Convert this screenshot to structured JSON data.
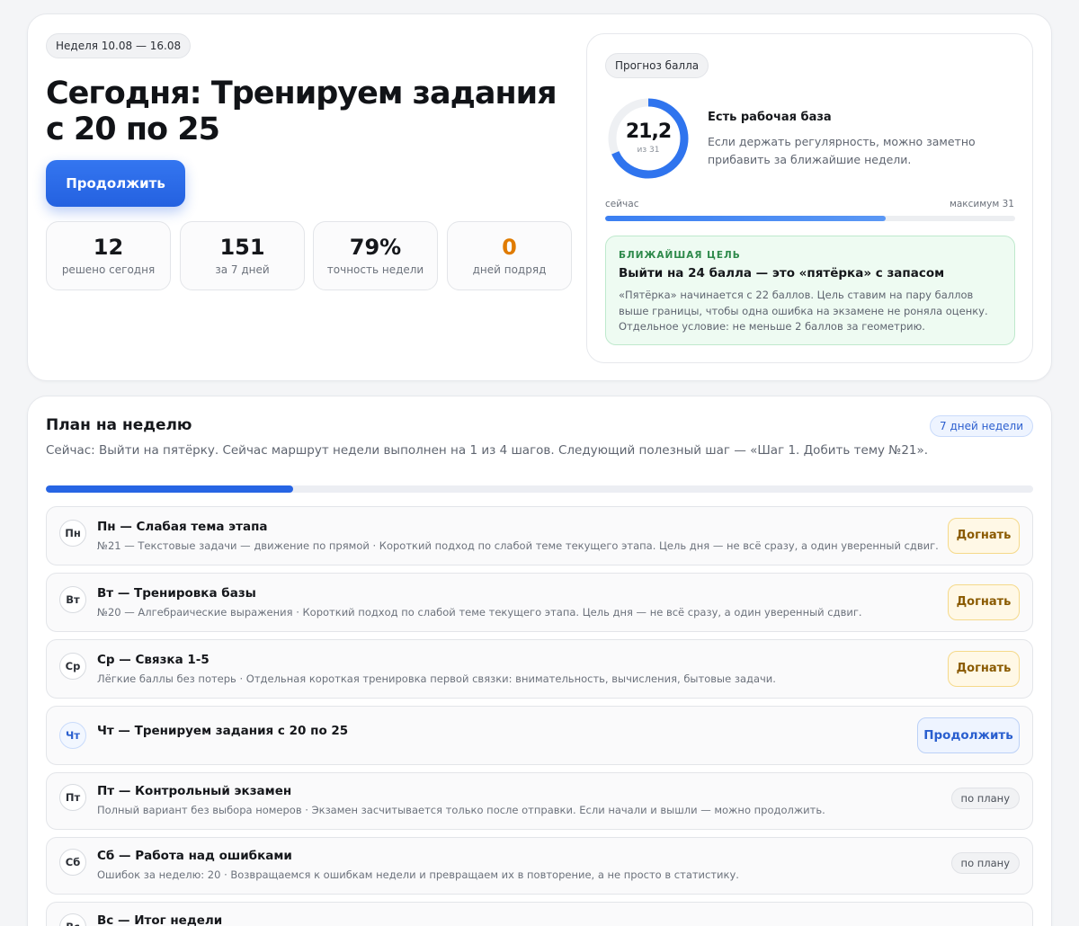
{
  "hero": {
    "week_label": "Неделя 10.08 — 16.08",
    "title": "Сегодня: Тренируем задания с 20 по 25",
    "continue_label": "Продолжить",
    "stats": [
      {
        "value": "12",
        "label": "решено сегодня"
      },
      {
        "value": "151",
        "label": "за 7 дней"
      },
      {
        "value": "79%",
        "label": "точность недели"
      },
      {
        "value": "0",
        "label": "дней подряд"
      }
    ]
  },
  "forecast": {
    "pill": "Прогноз балла",
    "score": "21,2",
    "score_max": "из 31",
    "score_value": 21.2,
    "score_total": 31,
    "status_title": "Есть рабочая база",
    "status_desc": "Если держать регулярность, можно заметно прибавить за ближайшие недели.",
    "now_label": "сейчас",
    "max_label": "максимум 31",
    "goal": {
      "kicker": "БЛИЖАЙШАЯ ЦЕЛЬ",
      "title": "Выйти на 24 балла — это «пятёрка» с запасом",
      "desc": "«Пятёрка» начинается с 22 баллов. Цель ставим на пару баллов выше границы, чтобы одна ошибка на экзамене не роняла оценку. Отдельное условие: не меньше 2 баллов за геометрию."
    }
  },
  "plan": {
    "title": "План на неделю",
    "days_pill": "7 дней недели",
    "subtitle": "Сейчас: Выйти на пятёрку. Сейчас маршрут недели выполнен на 1 из 4 шагов. Следующий полезный шаг — «Шаг 1. Добить тему №21».",
    "progress_fraction": 0.25,
    "rows": [
      {
        "badge": "Пн",
        "title": "Пн — Слабая тема этапа",
        "desc": "№21 — Текстовые задачи — движение по прямой · Короткий подход по слабой теме текущего этапа. Цель дня — не всё сразу, а один уверенный сдвиг.",
        "action": "Догнать"
      },
      {
        "badge": "Вт",
        "title": "Вт — Тренировка базы",
        "desc": "№20 — Алгебраические выражения · Короткий подход по слабой теме текущего этапа. Цель дня — не всё сразу, а один уверенный сдвиг.",
        "action": "Догнать"
      },
      {
        "badge": "Ср",
        "title": "Ср — Связка 1-5",
        "desc": "Лёгкие баллы без потерь · Отдельная короткая тренировка первой связки: внимательность, вычисления, бытовые задачи.",
        "action": "Догнать"
      },
      {
        "badge": "Чт",
        "title": "Чт — Тренируем задания с 20 по 25",
        "action": "Продолжить"
      },
      {
        "badge": "Пт",
        "title": "Пт — Контрольный экзамен",
        "desc": "Полный вариант без выбора номеров · Экзамен засчитывается только после отправки. Если начали и вышли — можно продолжить.",
        "action": "по плану"
      },
      {
        "badge": "Сб",
        "title": "Сб — Работа над ошибками",
        "desc": "Ошибок за неделю: 20 · Возвращаемся к ошибкам недели и превращаем их в повторение, а не просто в статистику.",
        "action": "по плану"
      },
      {
        "badge": "Вс",
        "title": "Вс — Итог недели"
      }
    ]
  },
  "colors": {
    "accent": "#2765e4",
    "streak": "#e07b00",
    "goal_bg": "#eefbf2",
    "goal_kicker": "#2e8a4b"
  }
}
